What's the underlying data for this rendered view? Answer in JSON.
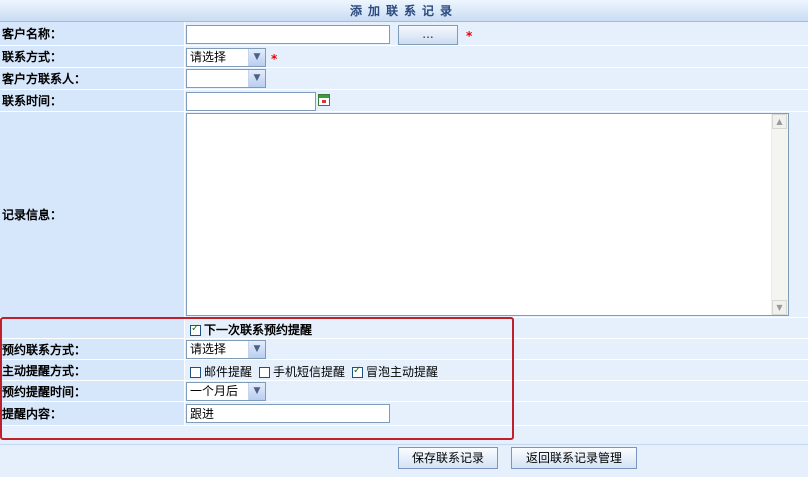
{
  "title": "添加联系记录",
  "form": {
    "customer_name_label": "客户名称：",
    "customer_name_value": "",
    "browse_button": "...",
    "contact_method_label": "联系方式：",
    "contact_method_value": "请选择",
    "customer_contact_label": "客户方联系人：",
    "customer_contact_value": "",
    "contact_time_label": "联系时间：",
    "contact_time_value": "",
    "record_info_label": "记录信息：",
    "record_info_value": "",
    "required_mark": "*"
  },
  "reminder": {
    "next_reminder_label": "下一次联系预约提醒",
    "next_reminder_checked": true,
    "reserve_method_label": "预约联系方式：",
    "reserve_method_value": "请选择",
    "active_reminder_label": "主动提醒方式：",
    "options": [
      {
        "label": "邮件提醒",
        "checked": false
      },
      {
        "label": "手机短信提醒",
        "checked": false
      },
      {
        "label": "冒泡主动提醒",
        "checked": true
      }
    ],
    "reminder_time_label": "预约提醒时间：",
    "reminder_time_value": "一个月后",
    "reminder_content_label": "提醒内容：",
    "reminder_content_value": "跟进"
  },
  "buttons": {
    "save": "保存联系记录",
    "back": "返回联系记录管理"
  },
  "colors": {
    "label_bg": "#d6e7fb",
    "value_bg": "#e6f0fc",
    "highlight_border": "#c0202a",
    "required": "#e00000"
  }
}
